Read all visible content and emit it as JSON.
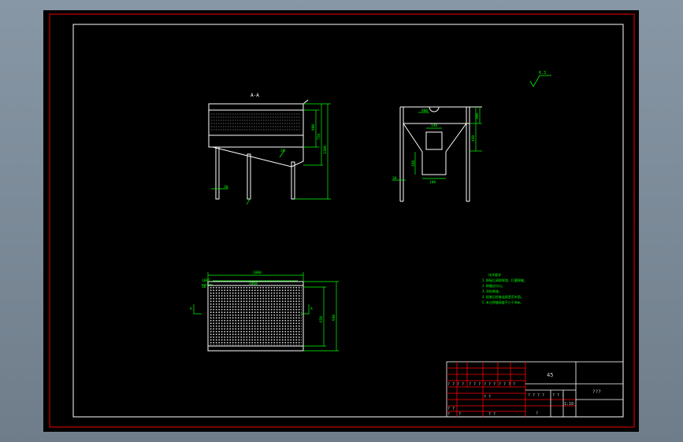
{
  "drawing": {
    "section_label": "A-A",
    "roughness_symbol": "6.3",
    "notes_heading": "技术要求",
    "notes": [
      "1.焊接后清除焊渣、打磨焊缝。",
      "2.焊缝应均匀。",
      "3.涂防锈漆。",
      "4.组装后检查连接是否牢固。",
      "5.未注焊缝高度不小于4mm。"
    ],
    "front_view": {
      "dims": [
        "990",
        "750",
        "1300",
        "30",
        "30"
      ]
    },
    "side_view": {
      "dims": [
        "300",
        "460",
        "900",
        "140",
        "100",
        "160",
        "30"
      ]
    },
    "top_view": {
      "dims": [
        "1000",
        "1060",
        "650",
        "940",
        "1001",
        "30",
        "A",
        "A"
      ]
    },
    "title_block": {
      "material": "45",
      "name": "???",
      "cells_row1": [
        "? ? ? ?",
        "? ? ?",
        "? ? ?",
        "? ? ? ?",
        "? ?",
        "? ?"
      ],
      "cells_row2": [
        "?",
        "?",
        "? ?"
      ],
      "scale_area": [
        "? ? ? ?",
        "? ? ?",
        "?",
        "1:10"
      ]
    }
  },
  "colors": {
    "outer_frame": "#c80000",
    "line": "#ffffff",
    "dimension": "#00ff00",
    "grid": "#ff0000"
  }
}
